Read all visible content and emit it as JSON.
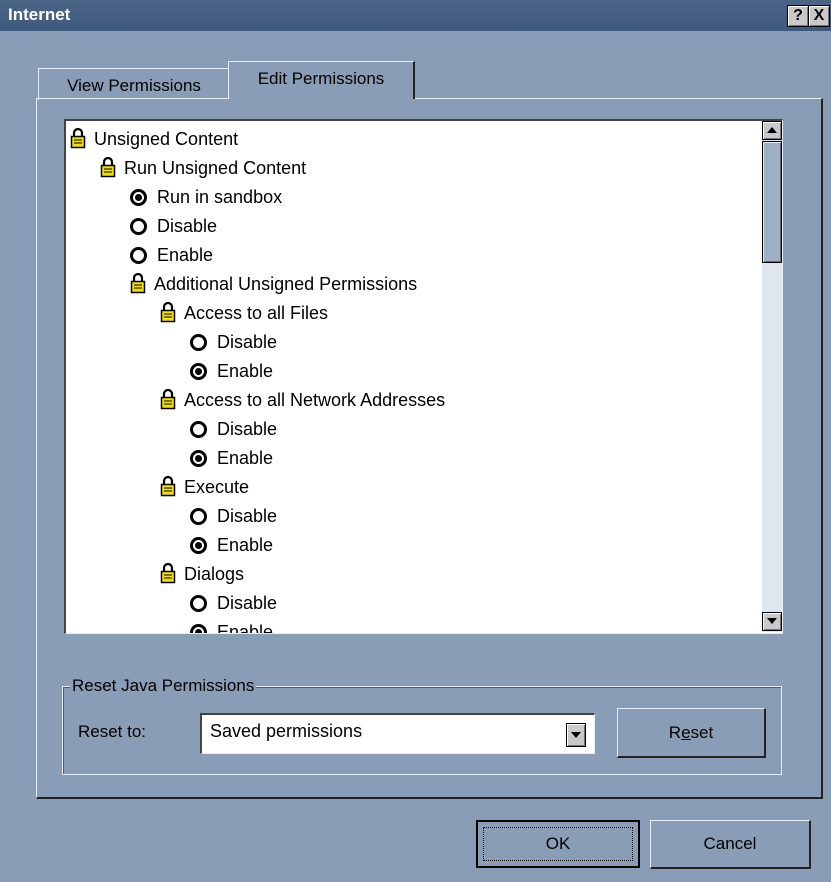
{
  "window": {
    "title": "Internet",
    "help_label": "?",
    "close_label": "X"
  },
  "tabs": [
    {
      "label": "View Permissions",
      "active": false
    },
    {
      "label": "Edit Permissions",
      "active": true
    }
  ],
  "tree": {
    "items": [
      {
        "type": "lock",
        "label": "Unsigned Content",
        "level": 0
      },
      {
        "type": "lock",
        "label": "Run Unsigned Content",
        "level": 1
      },
      {
        "type": "radio",
        "label": "Run in sandbox",
        "level": 2,
        "checked": true
      },
      {
        "type": "radio",
        "label": "Disable",
        "level": 2,
        "checked": false
      },
      {
        "type": "radio",
        "label": "Enable",
        "level": 2,
        "checked": false
      },
      {
        "type": "lock",
        "label": "Additional Unsigned Permissions",
        "level": 2
      },
      {
        "type": "lock",
        "label": "Access to all Files",
        "level": 3
      },
      {
        "type": "radio",
        "label": "Disable",
        "level": 4,
        "checked": false
      },
      {
        "type": "radio",
        "label": "Enable",
        "level": 4,
        "checked": true
      },
      {
        "type": "lock",
        "label": "Access to all Network Addresses",
        "level": 3
      },
      {
        "type": "radio",
        "label": "Disable",
        "level": 4,
        "checked": false
      },
      {
        "type": "radio",
        "label": "Enable",
        "level": 4,
        "checked": true
      },
      {
        "type": "lock",
        "label": "Execute",
        "level": 3
      },
      {
        "type": "radio",
        "label": "Disable",
        "level": 4,
        "checked": false
      },
      {
        "type": "radio",
        "label": "Enable",
        "level": 4,
        "checked": true
      },
      {
        "type": "lock",
        "label": "Dialogs",
        "level": 3
      },
      {
        "type": "radio",
        "label": "Disable",
        "level": 4,
        "checked": false
      },
      {
        "type": "radio",
        "label": "Enable",
        "level": 4,
        "checked": true
      }
    ]
  },
  "reset_group": {
    "legend": "Reset Java Permissions",
    "reset_to_label": "Reset to:",
    "selected_option": "Saved permissions",
    "reset_button": {
      "before": "R",
      "accel": "e",
      "after": "set"
    }
  },
  "footer": {
    "ok_label": "OK",
    "cancel_label": "Cancel"
  },
  "colors": {
    "background": "#8a9db7",
    "titlebar": "#4b6587",
    "lock_yellow": "#f2e100"
  }
}
